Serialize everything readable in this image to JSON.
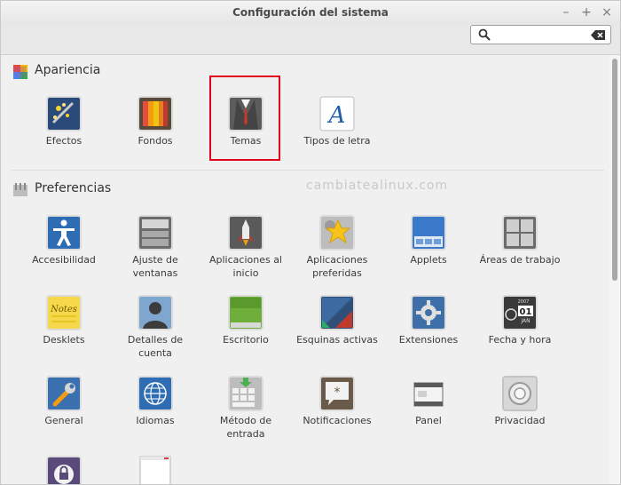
{
  "window": {
    "title": "Configuración del sistema",
    "minimize_glyph": "–",
    "maximize_glyph": "+",
    "close_glyph": "×"
  },
  "search": {
    "value": "",
    "placeholder": "",
    "search_icon": "search-icon",
    "clear_icon": "clear-icon"
  },
  "watermark": "cambiatealinux.com",
  "sections": {
    "apariencia": {
      "title": "Apariencia",
      "icon": "appearance-icon",
      "items": [
        {
          "label": "Efectos",
          "icon": "effects-icon"
        },
        {
          "label": "Fondos",
          "icon": "backgrounds-icon"
        },
        {
          "label": "Temas",
          "icon": "themes-icon"
        },
        {
          "label": "Tipos de letra",
          "icon": "fonts-icon"
        }
      ]
    },
    "preferencias": {
      "title": "Preferencias",
      "icon": "preferences-icon",
      "items": [
        {
          "label": "Accesibilidad",
          "icon": "accessibility-icon"
        },
        {
          "label": "Ajuste de ventanas",
          "icon": "window-tiling-icon"
        },
        {
          "label": "Aplicaciones al inicio",
          "icon": "startup-apps-icon"
        },
        {
          "label": "Aplicaciones preferidas",
          "icon": "preferred-apps-icon"
        },
        {
          "label": "Applets",
          "icon": "applets-icon"
        },
        {
          "label": "Áreas de trabajo",
          "icon": "workspaces-icon"
        },
        {
          "label": "Desklets",
          "icon": "desklets-icon"
        },
        {
          "label": "Detalles de cuenta",
          "icon": "account-details-icon"
        },
        {
          "label": "Escritorio",
          "icon": "desktop-icon"
        },
        {
          "label": "Esquinas activas",
          "icon": "hot-corners-icon"
        },
        {
          "label": "Extensiones",
          "icon": "extensions-icon"
        },
        {
          "label": "Fecha y hora",
          "icon": "date-time-icon"
        },
        {
          "label": "General",
          "icon": "general-icon"
        },
        {
          "label": "Idiomas",
          "icon": "languages-icon"
        },
        {
          "label": "Método de entrada",
          "icon": "input-method-icon"
        },
        {
          "label": "Notificaciones",
          "icon": "notifications-icon"
        },
        {
          "label": "Panel",
          "icon": "panel-icon"
        },
        {
          "label": "Privacidad",
          "icon": "privacy-icon"
        },
        {
          "label": "",
          "icon": "screensaver-lock-icon"
        },
        {
          "label": "",
          "icon": "document-icon"
        }
      ]
    }
  },
  "clock_icon_text": {
    "year": "2007",
    "day": "01",
    "month": "JAN"
  },
  "notes_icon_text": "Notes"
}
